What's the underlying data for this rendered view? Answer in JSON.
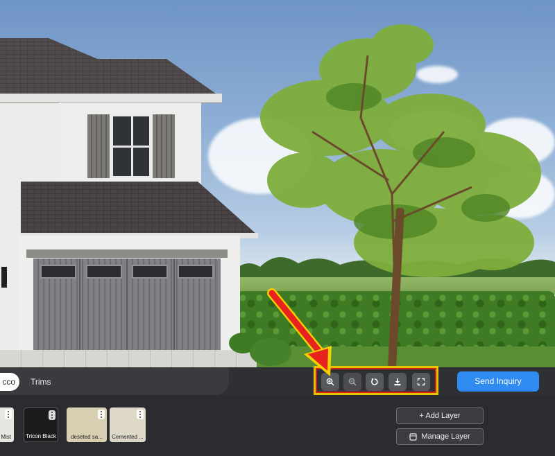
{
  "tabs": [
    {
      "label": "cco",
      "active": true
    },
    {
      "label": "Trims",
      "active": false
    }
  ],
  "view_tools": [
    {
      "icon": "zoom-in-icon",
      "enabled": true
    },
    {
      "icon": "zoom-out-icon",
      "enabled": false
    },
    {
      "icon": "reset-icon",
      "enabled": true
    },
    {
      "icon": "download-icon",
      "enabled": true
    },
    {
      "icon": "fullscreen-icon",
      "enabled": true
    }
  ],
  "send_inquiry_label": "Send Inquiry",
  "swatches": [
    {
      "label": "Mist",
      "color": "#e8e6e1"
    },
    {
      "label": "Tricon Black",
      "color": "#1c1c1e"
    },
    {
      "label": "deseted sa...",
      "color": "#d8cfb3"
    },
    {
      "label": "Cemented ...",
      "color": "#ddd8c7"
    }
  ],
  "layer_buttons": {
    "add": "+ Add Layer",
    "manage": "Manage Layer"
  },
  "colors": {
    "accent": "#2f8bf0",
    "highlight_frame": "#e7c400",
    "arrow": "#e8231f"
  }
}
